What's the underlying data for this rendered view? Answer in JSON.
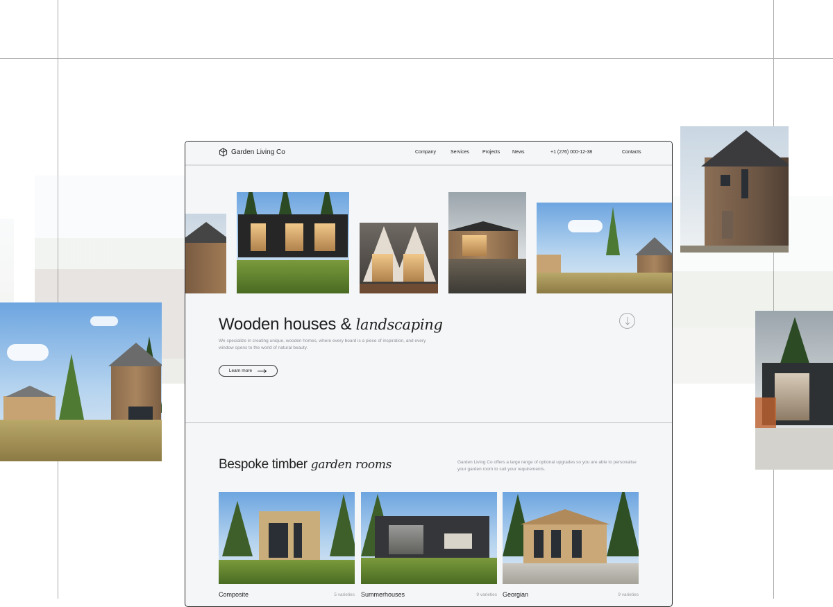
{
  "brand": {
    "name": "Garden Living Co",
    "logo_icon": "cube-icon"
  },
  "nav": {
    "links": [
      "Company",
      "Services",
      "Projects",
      "News"
    ],
    "phone": "+1 (276) 000-12-38",
    "contacts": "Contacts"
  },
  "hero": {
    "title_plain": "Wooden houses &",
    "title_italic": "landscaping",
    "description": "We specialize in creating unique, wooden homes, where every board is a piece of inspiration, and every window opens to the world of natural beauty.",
    "cta_label": "Learn more",
    "cta_icon": "arrow-right-icon",
    "scroll_icon": "arrow-down-icon"
  },
  "section": {
    "title_plain": "Bespoke timber",
    "title_italic": "garden rooms",
    "description": "Garden Living Co offers a large range of optional upgrades so you are able to personalise your garden room to suit your requirements."
  },
  "cards": [
    {
      "name": "Composite",
      "varieties": "5 varieties"
    },
    {
      "name": "Summerhouses",
      "varieties": "9 varieties"
    },
    {
      "name": "Georgian",
      "varieties": "9 varieties"
    }
  ],
  "colors": {
    "page_bg": "#f5f6f8",
    "text": "#1f1f1f",
    "muted": "#8b8f95",
    "guide": "#a9a9a9"
  }
}
